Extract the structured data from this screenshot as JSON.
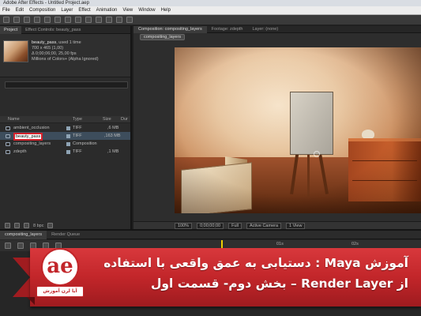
{
  "window": {
    "title": "Adobe After Effects - Untitled Project.aep"
  },
  "menu": [
    "File",
    "Edit",
    "Composition",
    "Layer",
    "Effect",
    "Animation",
    "View",
    "Window",
    "Help"
  ],
  "project_panel": {
    "tabs": [
      "Project",
      "Effect Controls: beauty_pass"
    ],
    "preview": {
      "name": "beauty_pass",
      "used": ", used 1 time",
      "dims": "700 x 465 (1,00)",
      "duration": "Δ 0;00;06;00, 25,00 fps",
      "colors": "Millions of Colors+ (Alpha Ignored)"
    },
    "columns": {
      "name": "Name",
      "type": "Type",
      "size": "Size",
      "dur": "Dur"
    },
    "items": [
      {
        "name": "ambient_occlusion",
        "type": "TIFF",
        "size": ",6 MB"
      },
      {
        "name": "beauty_pass",
        "type": "TIFF",
        "size": ",163 MB"
      },
      {
        "name": "compositing_layers",
        "type": "Composition",
        "size": ""
      },
      {
        "name": "zdepth",
        "type": "TIFF",
        "size": ",1 MB"
      }
    ],
    "bpc": "8 bpc"
  },
  "composition_panel": {
    "tabs": [
      "Composition: compositing_layers",
      "Footage: zdepth",
      "Layer: (none)"
    ],
    "comp_button": "compositing_layers",
    "controls": {
      "zoom": "100%",
      "timecode": "0;00;00;00",
      "quality": "Full",
      "camera": "Active Camera",
      "view": "1 View"
    }
  },
  "timeline": {
    "tabs": [
      "compositing_layers",
      "Render Queue"
    ],
    "ruler": [
      "01s",
      "02s"
    ]
  },
  "banner": {
    "line1": "آموزش Maya : دستیابی به عمق واقعی با استفاده",
    "line2": "از Render Layer – بخش دوم- قسمت اول"
  },
  "logo": {
    "badge": "آیا لرن آموزش"
  },
  "colors": {
    "banner_red": "#c2262a",
    "selection": "#d2202a"
  }
}
